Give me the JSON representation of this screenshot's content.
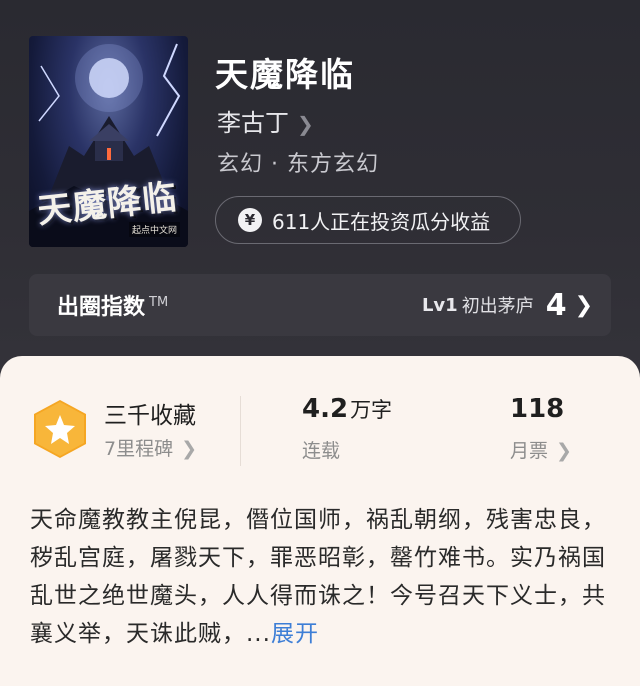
{
  "book": {
    "title": "天魔降临",
    "author": "李古丁",
    "genre": "玄幻 · 东方玄幻",
    "cover_title": "天魔降临",
    "cover_publisher": "起点中文网"
  },
  "invest": {
    "icon": "yen-icon",
    "text": "611人正在投资瓜分收益"
  },
  "index": {
    "label": "出圈指数",
    "tm": "TM",
    "level": "Lv1",
    "level_name": "初出茅庐",
    "value": "4"
  },
  "stats": {
    "favorites": {
      "name": "三千收藏",
      "sub": "7里程碑"
    },
    "words": {
      "value": "4.2",
      "unit": "万字",
      "status": "连载"
    },
    "tickets": {
      "value": "118",
      "label": "月票"
    }
  },
  "synopsis": {
    "text": "天命魔教教主倪昆，僭位国师，祸乱朝纲，残害忠良，秽乱宫庭，屠戮天下，罪恶昭彰，罄竹难书。实乃祸国乱世之绝世魔头，人人得而诛之！今号召天下义士，共襄义举，天诛此贼，",
    "ellipsis": "...",
    "more": "展开"
  },
  "colors": {
    "accent": "#f5a623",
    "link": "#3d7ed6",
    "card_bg": "#fbf4ef"
  }
}
